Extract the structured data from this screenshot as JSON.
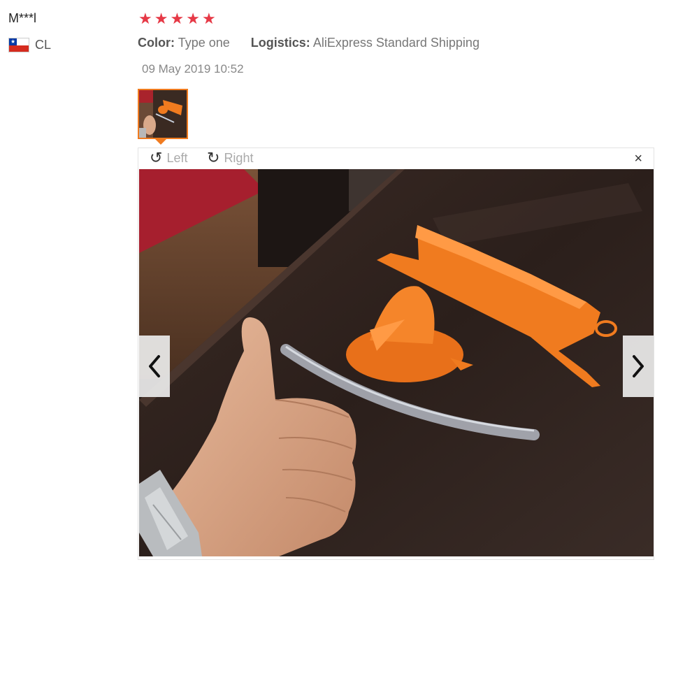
{
  "reviewer": {
    "name": "M***l",
    "country_code": "CL"
  },
  "rating": {
    "stars": 5,
    "max": 5,
    "color": "#e63946"
  },
  "meta": {
    "color_label": "Color:",
    "color_value": "Type one",
    "logistics_label": "Logistics:",
    "logistics_value": "AliExpress Standard Shipping"
  },
  "date": "09 May 2019 10:52",
  "viewer": {
    "rotate_left_label": "Left",
    "rotate_right_label": "Right",
    "close_glyph": "×"
  },
  "colors": {
    "accent": "#f07b1f"
  }
}
